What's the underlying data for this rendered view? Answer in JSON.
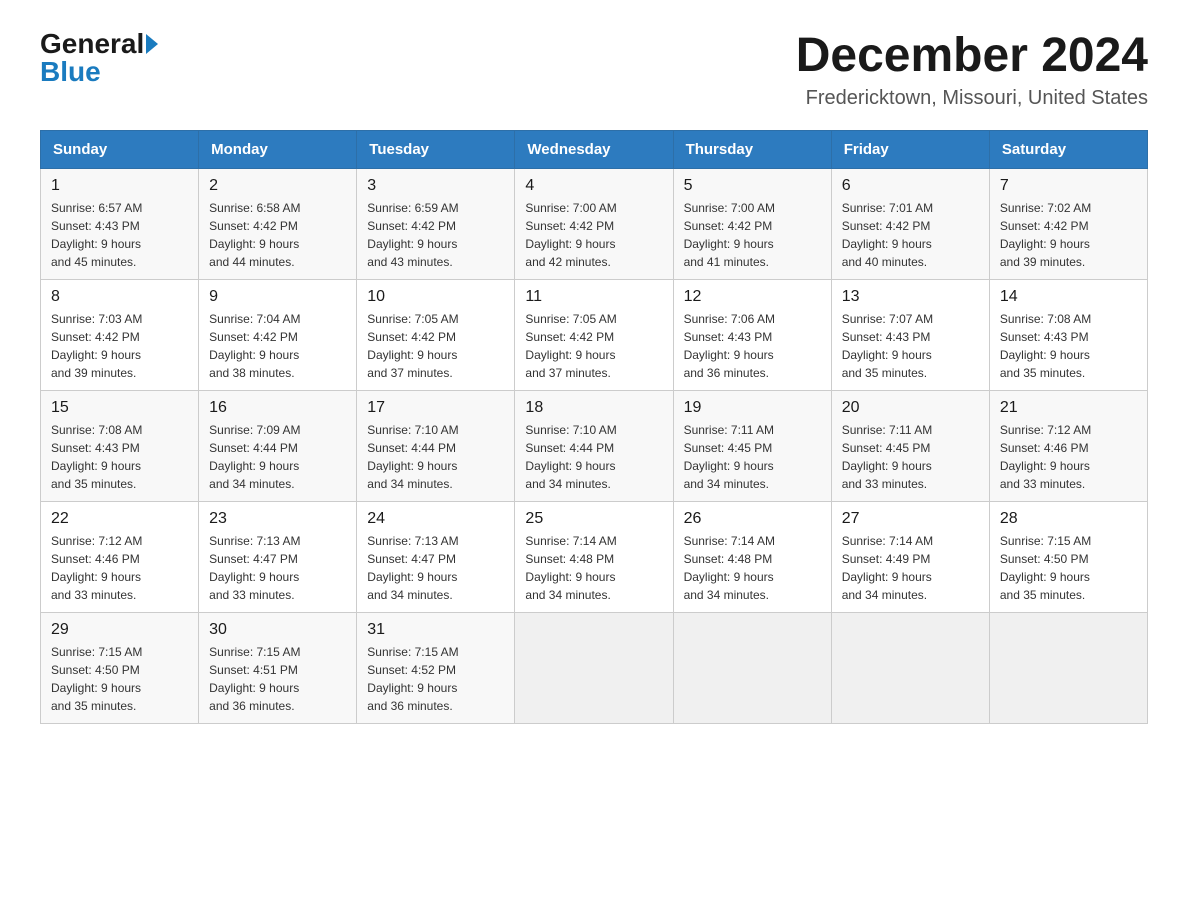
{
  "header": {
    "logo_general": "General",
    "logo_blue": "Blue",
    "title": "December 2024",
    "subtitle": "Fredericktown, Missouri, United States"
  },
  "weekdays": [
    "Sunday",
    "Monday",
    "Tuesday",
    "Wednesday",
    "Thursday",
    "Friday",
    "Saturday"
  ],
  "weeks": [
    [
      {
        "day": "1",
        "sunrise": "6:57 AM",
        "sunset": "4:43 PM",
        "daylight": "9 hours and 45 minutes."
      },
      {
        "day": "2",
        "sunrise": "6:58 AM",
        "sunset": "4:42 PM",
        "daylight": "9 hours and 44 minutes."
      },
      {
        "day": "3",
        "sunrise": "6:59 AM",
        "sunset": "4:42 PM",
        "daylight": "9 hours and 43 minutes."
      },
      {
        "day": "4",
        "sunrise": "7:00 AM",
        "sunset": "4:42 PM",
        "daylight": "9 hours and 42 minutes."
      },
      {
        "day": "5",
        "sunrise": "7:00 AM",
        "sunset": "4:42 PM",
        "daylight": "9 hours and 41 minutes."
      },
      {
        "day": "6",
        "sunrise": "7:01 AM",
        "sunset": "4:42 PM",
        "daylight": "9 hours and 40 minutes."
      },
      {
        "day": "7",
        "sunrise": "7:02 AM",
        "sunset": "4:42 PM",
        "daylight": "9 hours and 39 minutes."
      }
    ],
    [
      {
        "day": "8",
        "sunrise": "7:03 AM",
        "sunset": "4:42 PM",
        "daylight": "9 hours and 39 minutes."
      },
      {
        "day": "9",
        "sunrise": "7:04 AM",
        "sunset": "4:42 PM",
        "daylight": "9 hours and 38 minutes."
      },
      {
        "day": "10",
        "sunrise": "7:05 AM",
        "sunset": "4:42 PM",
        "daylight": "9 hours and 37 minutes."
      },
      {
        "day": "11",
        "sunrise": "7:05 AM",
        "sunset": "4:42 PM",
        "daylight": "9 hours and 37 minutes."
      },
      {
        "day": "12",
        "sunrise": "7:06 AM",
        "sunset": "4:43 PM",
        "daylight": "9 hours and 36 minutes."
      },
      {
        "day": "13",
        "sunrise": "7:07 AM",
        "sunset": "4:43 PM",
        "daylight": "9 hours and 35 minutes."
      },
      {
        "day": "14",
        "sunrise": "7:08 AM",
        "sunset": "4:43 PM",
        "daylight": "9 hours and 35 minutes."
      }
    ],
    [
      {
        "day": "15",
        "sunrise": "7:08 AM",
        "sunset": "4:43 PM",
        "daylight": "9 hours and 35 minutes."
      },
      {
        "day": "16",
        "sunrise": "7:09 AM",
        "sunset": "4:44 PM",
        "daylight": "9 hours and 34 minutes."
      },
      {
        "day": "17",
        "sunrise": "7:10 AM",
        "sunset": "4:44 PM",
        "daylight": "9 hours and 34 minutes."
      },
      {
        "day": "18",
        "sunrise": "7:10 AM",
        "sunset": "4:44 PM",
        "daylight": "9 hours and 34 minutes."
      },
      {
        "day": "19",
        "sunrise": "7:11 AM",
        "sunset": "4:45 PM",
        "daylight": "9 hours and 34 minutes."
      },
      {
        "day": "20",
        "sunrise": "7:11 AM",
        "sunset": "4:45 PM",
        "daylight": "9 hours and 33 minutes."
      },
      {
        "day": "21",
        "sunrise": "7:12 AM",
        "sunset": "4:46 PM",
        "daylight": "9 hours and 33 minutes."
      }
    ],
    [
      {
        "day": "22",
        "sunrise": "7:12 AM",
        "sunset": "4:46 PM",
        "daylight": "9 hours and 33 minutes."
      },
      {
        "day": "23",
        "sunrise": "7:13 AM",
        "sunset": "4:47 PM",
        "daylight": "9 hours and 33 minutes."
      },
      {
        "day": "24",
        "sunrise": "7:13 AM",
        "sunset": "4:47 PM",
        "daylight": "9 hours and 34 minutes."
      },
      {
        "day": "25",
        "sunrise": "7:14 AM",
        "sunset": "4:48 PM",
        "daylight": "9 hours and 34 minutes."
      },
      {
        "day": "26",
        "sunrise": "7:14 AM",
        "sunset": "4:48 PM",
        "daylight": "9 hours and 34 minutes."
      },
      {
        "day": "27",
        "sunrise": "7:14 AM",
        "sunset": "4:49 PM",
        "daylight": "9 hours and 34 minutes."
      },
      {
        "day": "28",
        "sunrise": "7:15 AM",
        "sunset": "4:50 PM",
        "daylight": "9 hours and 35 minutes."
      }
    ],
    [
      {
        "day": "29",
        "sunrise": "7:15 AM",
        "sunset": "4:50 PM",
        "daylight": "9 hours and 35 minutes."
      },
      {
        "day": "30",
        "sunrise": "7:15 AM",
        "sunset": "4:51 PM",
        "daylight": "9 hours and 36 minutes."
      },
      {
        "day": "31",
        "sunrise": "7:15 AM",
        "sunset": "4:52 PM",
        "daylight": "9 hours and 36 minutes."
      },
      null,
      null,
      null,
      null
    ]
  ],
  "labels": {
    "sunrise": "Sunrise:",
    "sunset": "Sunset:",
    "daylight": "Daylight:"
  }
}
